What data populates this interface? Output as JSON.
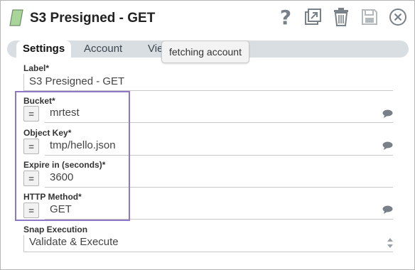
{
  "header": {
    "title": "S3 Presigned - GET",
    "icons": [
      "snap-leaf-icon",
      "help-icon",
      "expand-icon",
      "delete-icon",
      "save-icon",
      "close-icon"
    ],
    "help_glyph": "?"
  },
  "tabs": [
    {
      "label": "Settings",
      "active": true
    },
    {
      "label": "Account",
      "active": false
    },
    {
      "label": "Views",
      "active": false
    }
  ],
  "tooltip": "fetching account",
  "fields": {
    "label": {
      "label": "Label*",
      "value": "S3 Presigned - GET"
    },
    "bucket": {
      "label": "Bucket*",
      "value": "mrtest"
    },
    "object_key": {
      "label": "Object Key*",
      "value": "tmp/hello.json"
    },
    "expire": {
      "label": "Expire in (seconds)*",
      "value": "3600"
    },
    "http_method": {
      "label": "HTTP Method*",
      "value": "GET"
    },
    "snap_execution": {
      "label": "Snap Execution",
      "value": "Validate & Execute"
    }
  },
  "expression_toggle": "=",
  "colors": {
    "highlight": "#8e77c7",
    "tab_bar": "#d9dee2",
    "icon_gray": "#7a8088",
    "snap_icon_fill": "#a9d49a"
  }
}
